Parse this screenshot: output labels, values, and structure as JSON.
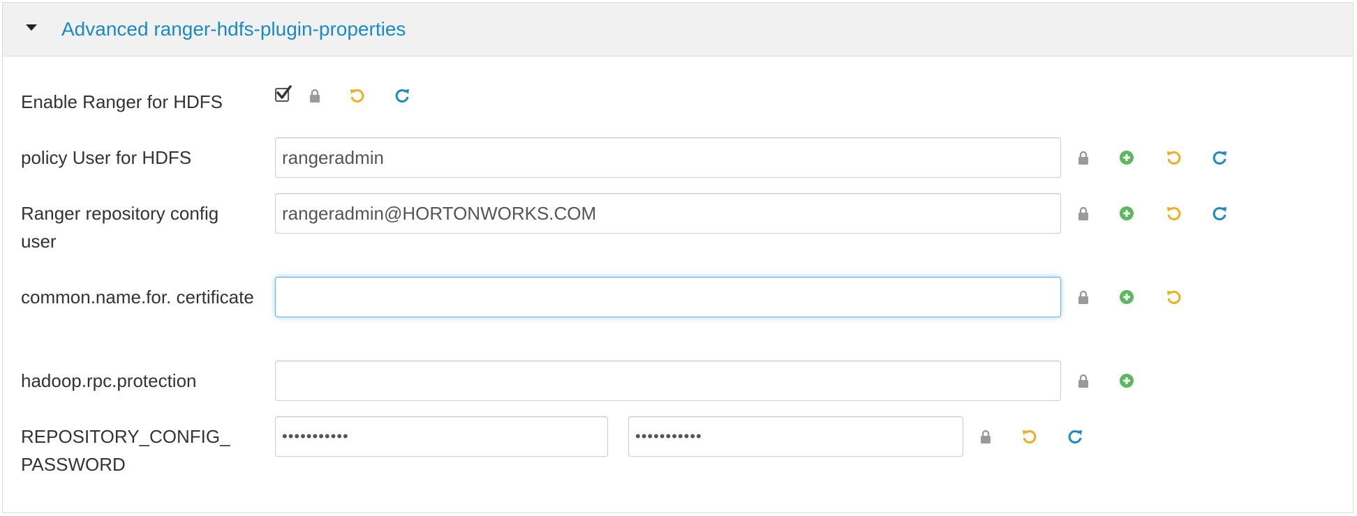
{
  "section": {
    "title": "Advanced ranger-hdfs-plugin-properties",
    "expanded": true
  },
  "rows": [
    {
      "label": "Enable Ranger for HDFS",
      "type": "checkbox",
      "checked": true
    },
    {
      "label": "policy User for HDFS",
      "type": "text",
      "value": "rangeradmin"
    },
    {
      "label": "Ranger repository config user",
      "type": "text",
      "value": "rangeradmin@HORTONWORKS.COM"
    },
    {
      "label": "common.name.for. certificate",
      "type": "text",
      "value": "",
      "focused": true
    },
    {
      "label": "hadoop.rpc.protection",
      "type": "text",
      "value": ""
    },
    {
      "label": "REPOSITORY_CONFIG_ PASSWORD",
      "type": "password",
      "value": "•••••••••••",
      "confirm_value": "•••••••••••"
    }
  ],
  "icons": {
    "lock": "lock-icon",
    "override": "plus-circle-icon",
    "undo": "undo-icon",
    "refresh": "refresh-icon"
  },
  "colors": {
    "title": "#1a8ac6",
    "lock": "#9a9a9a",
    "override": "#5cb85c",
    "undo": "#f0ad1e",
    "refresh": "#1a8ac6"
  }
}
